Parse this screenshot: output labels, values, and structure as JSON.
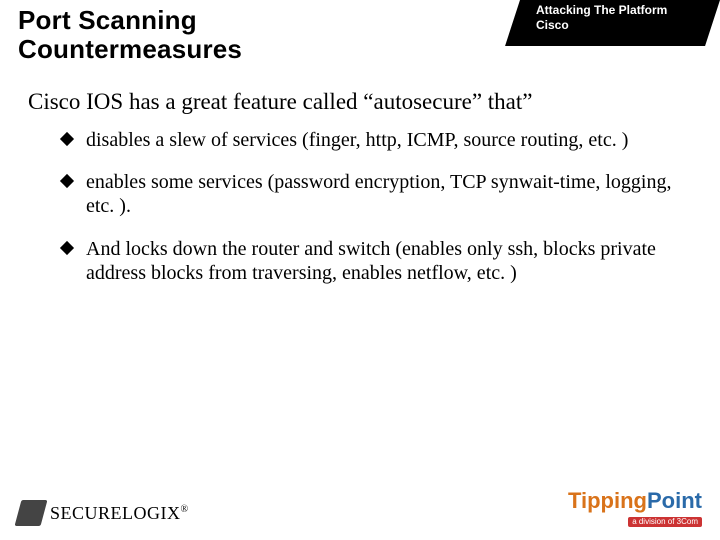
{
  "header": {
    "title_line1": "Port Scanning",
    "title_line2": "Countermeasures",
    "tab_line1": "Attacking The Platform",
    "tab_line2": "Cisco"
  },
  "body": {
    "lead": "Cisco IOS has a great feature called “autosecure” that”",
    "bullets": [
      "disables a slew of services (finger, http, ICMP, source routing, etc. )",
      "enables some services (password encryption, TCP synwait-time, logging, etc. ).",
      "And locks down the router and switch (enables only ssh, blocks private address blocks from traversing, enables netflow, etc. )"
    ]
  },
  "footer": {
    "left_logo_text": "SECURELOGIX",
    "left_logo_reg": "®",
    "right_logo_tip": "Tipping",
    "right_logo_point": "Point",
    "right_logo_tag": "a division of 3Com"
  }
}
